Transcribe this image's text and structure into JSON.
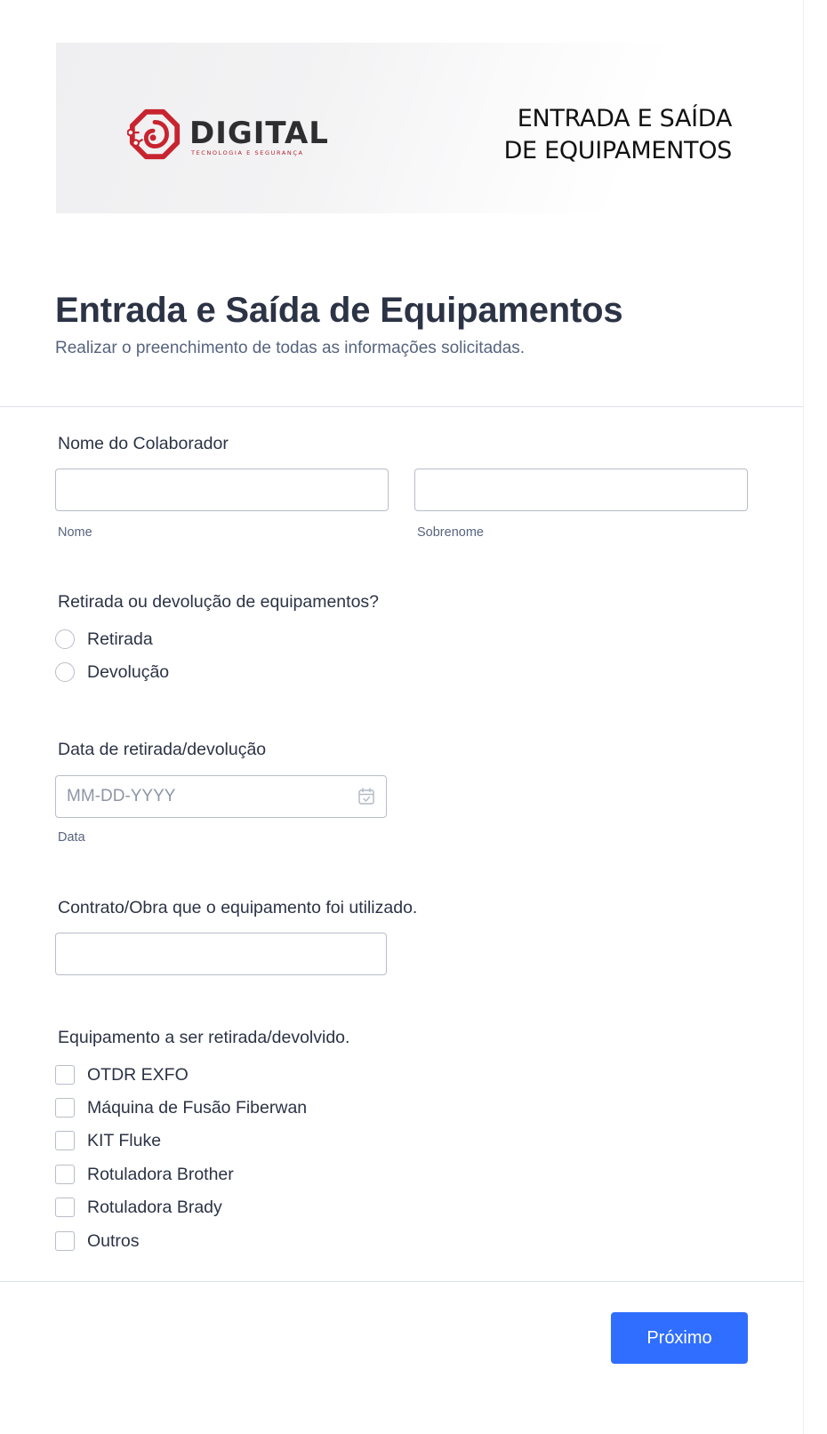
{
  "banner": {
    "logo_word": "DIGITAL",
    "logo_tagline": "TECNOLOGIA E SEGURANÇA",
    "title_line1": "ENTRADA E SAÍDA",
    "title_line2": "DE EQUIPAMENTOS",
    "brand_color": "#c8242f"
  },
  "header": {
    "title": "Entrada e Saída de Equipamentos",
    "subtitle": "Realizar o preenchimento de todas as informações solicitadas."
  },
  "fields": {
    "name": {
      "label": "Nome do Colaborador",
      "first_sublabel": "Nome",
      "first_value": "",
      "last_sublabel": "Sobrenome",
      "last_value": ""
    },
    "type": {
      "label": "Retirada ou devolução de equipamentos?",
      "options": [
        "Retirada",
        "Devolução"
      ]
    },
    "date": {
      "label": "Data de retirada/devolução",
      "placeholder": "MM-DD-YYYY",
      "sublabel": "Data",
      "icon": "calendar-icon"
    },
    "contract": {
      "label": "Contrato/Obra que o equipamento foi utilizado.",
      "value": ""
    },
    "equipment": {
      "label": "Equipamento a ser retirada/devolvido.",
      "options": [
        "OTDR EXFO",
        "Máquina de Fusão Fiberwan",
        "KIT Fluke",
        "Rotuladora Brother",
        "Rotuladora Brady",
        "Outros"
      ]
    }
  },
  "footer": {
    "next_label": "Próximo",
    "button_color": "#2f6eff"
  }
}
